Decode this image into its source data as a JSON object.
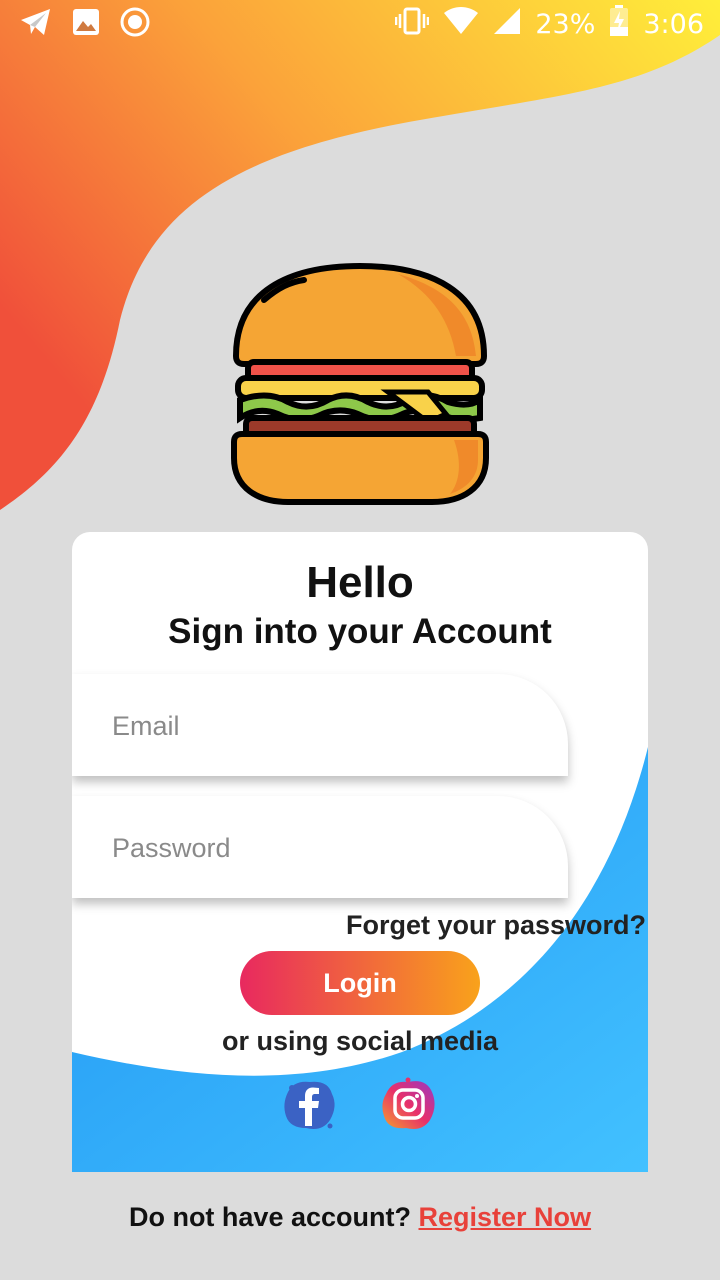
{
  "status_bar": {
    "battery": "23%",
    "time": "3:06",
    "icons": [
      "telegram-icon",
      "gallery-icon",
      "record-icon",
      "vibrate-icon",
      "wifi-icon",
      "signal-icon",
      "battery-charging-icon"
    ]
  },
  "card": {
    "title": "Hello",
    "subtitle": "Sign into your Account",
    "email_placeholder": "Email",
    "email_value": "",
    "password_placeholder": "Password",
    "password_value": "",
    "forgot_label": "Forget your password?",
    "login_label": "Login",
    "social_text": "or using social media",
    "social_icons": [
      "facebook-icon",
      "instagram-icon"
    ]
  },
  "footer": {
    "question": "Do not have account?",
    "register_label": "Register Now"
  },
  "colors": {
    "background": "#dcdcdc",
    "orange_gradient": [
      "#f0503a",
      "#fbb034",
      "#ffe93a"
    ],
    "blue_gradient": [
      "#2196f3",
      "#42c1ff"
    ],
    "login_gradient": [
      "#e8295f",
      "#f9a21b"
    ],
    "register_link": "#e8413a"
  }
}
